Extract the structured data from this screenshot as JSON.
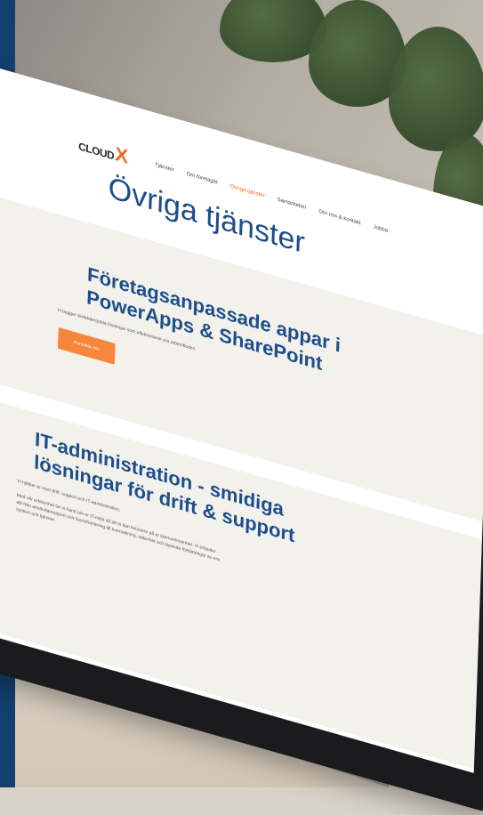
{
  "site": {
    "logo_text": "CLOUD",
    "logo_mark": "X",
    "nav": [
      "Tjänster",
      "Om företaget",
      "Övriga tjänster",
      "Samarbeten",
      "Om oss & kontakt",
      "Jobba"
    ],
    "active_nav_index": 2,
    "page_title": "Övriga tjänster",
    "section1": {
      "heading": "Företagsanpassade appar i PowerApps & SharePoint",
      "description": "Vi bygger skräddarsydda lösningar som effektiviserar era arbetsflöden.",
      "button_label": "Kontakta oss"
    },
    "section2": {
      "heading": "IT-administration - smidiga lösningar för drift & support",
      "lead": "Vi hjälper er med drift, support och IT-administration.",
      "paragraph": "Med vår erfarenhet tar vi hand om er IT-miljö så att ni kan fokusera på er kärnverksamhet. Vi erbjuder allt från användarsupport och licenshantering till övervakning, säkerhet och löpande förbättringar av era system och tjänster."
    }
  },
  "colors": {
    "sidebar": "#13406f",
    "brand_blue": "#1e4e8a",
    "accent_orange": "#f26722"
  }
}
